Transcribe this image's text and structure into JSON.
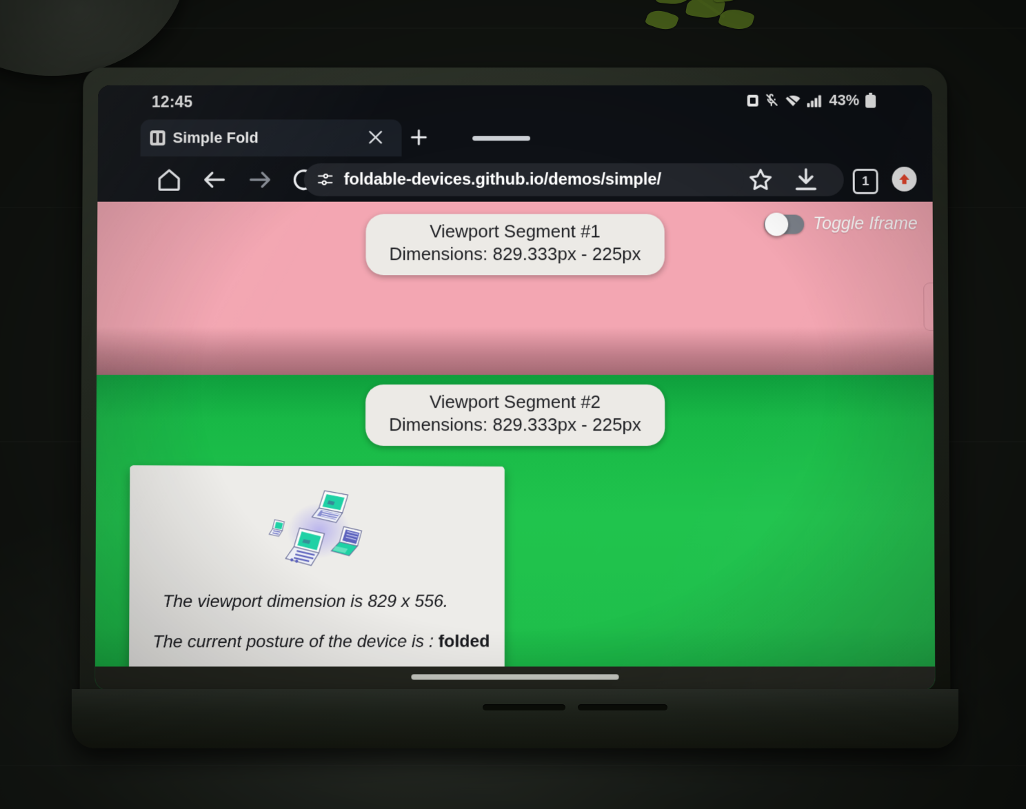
{
  "status_bar": {
    "clock": "12:45",
    "battery_percent": "43%",
    "icons": [
      "screenshot-icon",
      "mic-off-icon",
      "wifi-icon",
      "cellular-signal-icon",
      "battery-icon"
    ]
  },
  "browser": {
    "tab": {
      "title": "Simple Fold",
      "favicon": "simple-fold-favicon",
      "close_label": "×"
    },
    "new_tab_label": "+",
    "toolbar": {
      "home_icon": "home-icon",
      "back_icon": "back-arrow-icon",
      "forward_icon": "forward-arrow-icon",
      "reload_icon": "reload-icon",
      "site_info_icon": "site-settings-icon",
      "url": "foldable-devices.github.io/demos/simple/",
      "bookmark_icon": "star-icon",
      "download_icon": "download-icon",
      "tab_count": "1",
      "menu_icon": "menu-update-icon"
    }
  },
  "page": {
    "segments": [
      {
        "title": "Viewport Segment #1",
        "dimensions": "Dimensions: 829.333px - 225px",
        "color": "#f3a6b2"
      },
      {
        "title": "Viewport Segment #2",
        "dimensions": "Dimensions: 829.333px - 225px",
        "color": "#20c44d"
      }
    ],
    "toggle": {
      "label": "Toggle Iframe",
      "state": "off"
    },
    "card": {
      "illustration": "foldable-laptops-illustration",
      "viewport_line": "The viewport dimension is 829 x 556.",
      "posture_prefix": "The current posture of the device is : ",
      "posture_value": "folded"
    }
  },
  "system_nav": {
    "gesture_pill": "gesture-navigation-bar"
  },
  "colors": {
    "segment_1": "#f3a6b2",
    "segment_2": "#20c44d",
    "card_bg": "#edece9",
    "chrome_bg": "#0e1116",
    "omnibox_bg": "#23262c"
  }
}
